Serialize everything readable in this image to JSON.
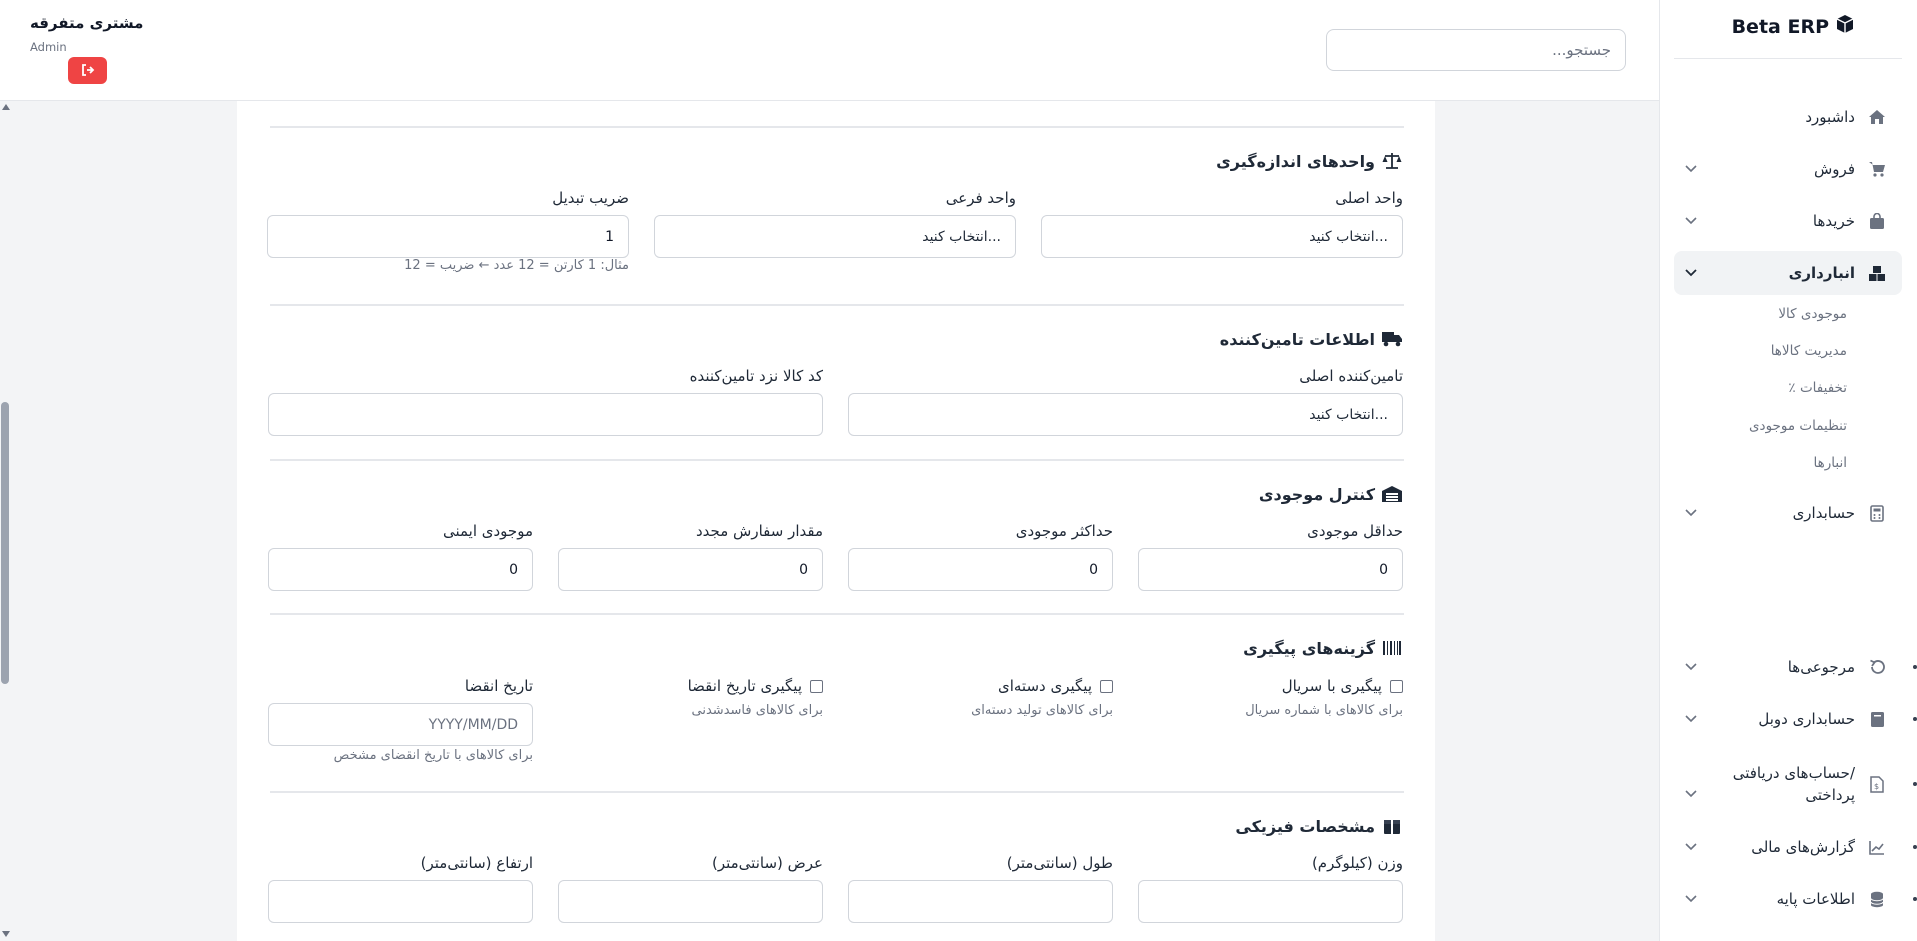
{
  "brand": {
    "title": "Beta ERP",
    "icon": "cube-icon"
  },
  "search": {
    "placeholder": "جستجو..."
  },
  "user": {
    "name": "مشتری متفرقه",
    "role": "Admin",
    "logout_icon": "sign-out-icon",
    "logout_color": "#ef4444"
  },
  "sidebar": {
    "items": [
      {
        "label": "داشبورد",
        "icon": "home-icon"
      },
      {
        "label": "فروش",
        "icon": "cart-icon"
      },
      {
        "label": "خریدها",
        "icon": "bag-icon"
      },
      {
        "label": "انبارداری",
        "icon": "boxes-icon"
      },
      {
        "label": "حسابداری",
        "icon": "calculator-icon"
      },
      {
        "label": "مرجوعی‌ها",
        "icon": "undo-icon"
      },
      {
        "label": "حسابداری دوبل",
        "icon": "book-icon"
      },
      {
        "label": "حساب‌های دریافتی/\nپرداختی",
        "icon": "invoice-icon"
      },
      {
        "label": "گزارش‌های مالی",
        "icon": "chart-icon"
      },
      {
        "label": "اطلاعات پایه",
        "icon": "database-icon"
      }
    ],
    "sub_items": [
      {
        "label": "موجودی کالا"
      },
      {
        "label": "مدیریت کالاها"
      },
      {
        "label": "٪ تخفیفات"
      },
      {
        "label": "تنظیمات موجودی"
      },
      {
        "label": "انبارها"
      }
    ]
  },
  "sections": {
    "units": {
      "title": "واحدهای اندازه‌گیری",
      "icon": "balance-scale-icon",
      "main_unit": {
        "label": "واحد اصلی",
        "value": "انتخاب کنید..."
      },
      "sub_unit": {
        "label": "واحد فرعی",
        "value": "انتخاب کنید..."
      },
      "conversion": {
        "label": "ضریب تبدیل",
        "value": "1",
        "hint": "مثال: 1 کارتن = 12 عدد ← ضریب = 12"
      }
    },
    "supplier": {
      "title": "اطلاعات تامین‌کننده",
      "icon": "truck-icon",
      "main_supplier": {
        "label": "تامین‌کننده اصلی",
        "value": "انتخاب کنید..."
      },
      "supplier_code": {
        "label": "کد کالا نزد تامین‌کننده",
        "value": ""
      }
    },
    "stock": {
      "title": "کنترل موجودی",
      "icon": "warehouse-icon",
      "min": {
        "label": "حداقل موجودی",
        "value": "0"
      },
      "max": {
        "label": "حداکثر موجودی",
        "value": "0"
      },
      "reorder": {
        "label": "مقدار سفارش مجدد",
        "value": "0"
      },
      "safety": {
        "label": "موجودی ایمنی",
        "value": "0"
      }
    },
    "tracking": {
      "title": "گزینه‌های پیگیری",
      "icon": "barcode-icon",
      "serial": {
        "label": "پیگیری با سریال",
        "hint": "برای کالاهای با شماره سریال",
        "checked": false
      },
      "batch": {
        "label": "پیگیری دسته‌ای",
        "hint": "برای کالاهای تولید دسته‌ای",
        "checked": false
      },
      "expiry_tracking": {
        "label": "پیگیری تاریخ انقضا",
        "hint": "برای کالاهای فاسدشدنی",
        "checked": false
      },
      "expiry_date": {
        "label": "تاریخ انقضا",
        "placeholder": "YYYY/MM/DD",
        "hint": "برای کالاهای با تاریخ انقضای مشخص"
      }
    },
    "physical": {
      "title": "مشخصات فیزیکی",
      "icon": "box-icon",
      "weight": {
        "label": "وزن (کیلوگرم)",
        "value": ""
      },
      "length": {
        "label": "طول (سانتی‌متر)",
        "value": ""
      },
      "width": {
        "label": "عرض (سانتی‌متر)",
        "value": ""
      },
      "height": {
        "label": "ارتفاع (سانتی‌متر)",
        "value": ""
      }
    }
  }
}
